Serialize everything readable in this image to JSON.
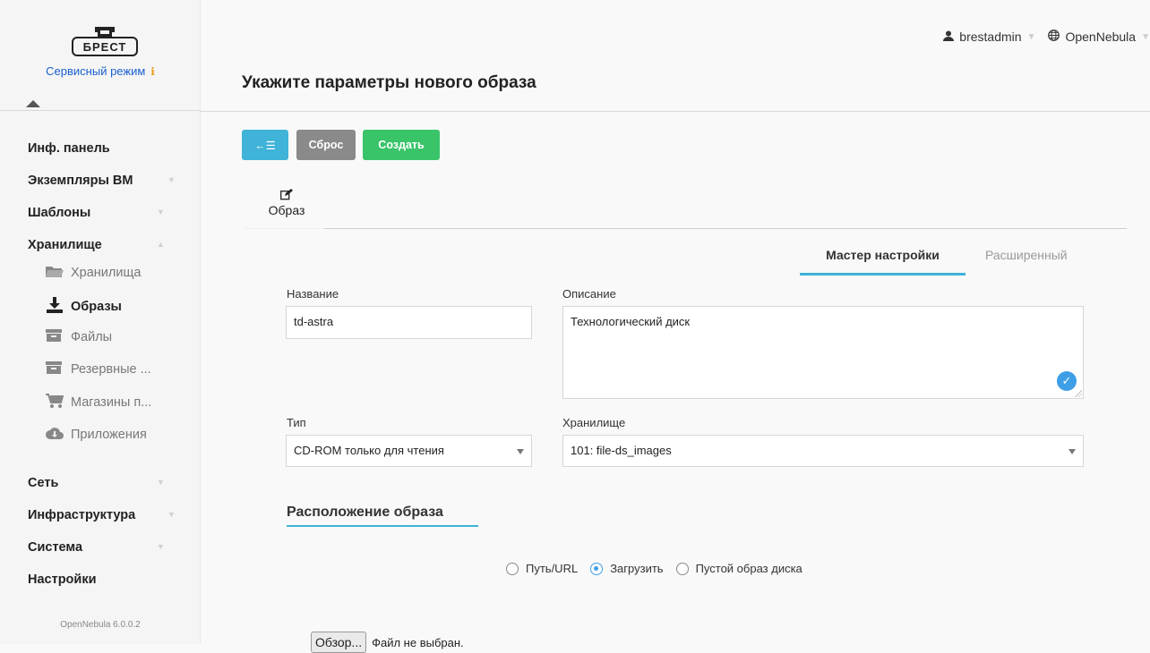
{
  "sidebar": {
    "logo_text": "БРЕСТ",
    "mode_label": "Сервисный режим",
    "mode_info_icon": "info-icon",
    "version": "OpenNebula 6.0.0.2",
    "items": {
      "dashboard": "Инф. панель",
      "vms": "Экземпляры ВМ",
      "templates": "Шаблоны",
      "storage": "Хранилище",
      "network": "Сеть",
      "infrastructure": "Инфраструктура",
      "system": "Система",
      "settings": "Настройки"
    },
    "storage_sub": {
      "datastores": "Хранилища",
      "images": "Образы",
      "files": "Файлы",
      "backups": "Резервные ...",
      "marketplaces": "Магазины п...",
      "apps": "Приложения"
    }
  },
  "header": {
    "user": "brestadmin",
    "zone": "OpenNebula"
  },
  "page": {
    "title": "Укажите параметры нового образа"
  },
  "toolbar": {
    "back_icon": "←☰",
    "reset_label": "Сброс",
    "create_label": "Создать"
  },
  "tabs": {
    "image_label": "Образ",
    "wizard_label": "Мастер настройки",
    "advanced_label": "Расширенный"
  },
  "form": {
    "name_label": "Название",
    "name_value": "td-astra",
    "description_label": "Описание",
    "description_value": "Технологический диск",
    "type_label": "Тип",
    "type_value": "CD-ROM только для чтения",
    "datastore_label": "Хранилище",
    "datastore_value": "101: file-ds_images",
    "location_title": "Расположение образа",
    "radio_path": "Путь/URL",
    "radio_upload": "Загрузить",
    "radio_empty": "Пустой образ диска",
    "browse_label": "Обзор...",
    "no_file": "Файл не выбран."
  },
  "colors": {
    "accent": "#3fb3d8",
    "create": "#39c46a",
    "reset": "#8a8a8a",
    "link": "#1a5fd0"
  }
}
